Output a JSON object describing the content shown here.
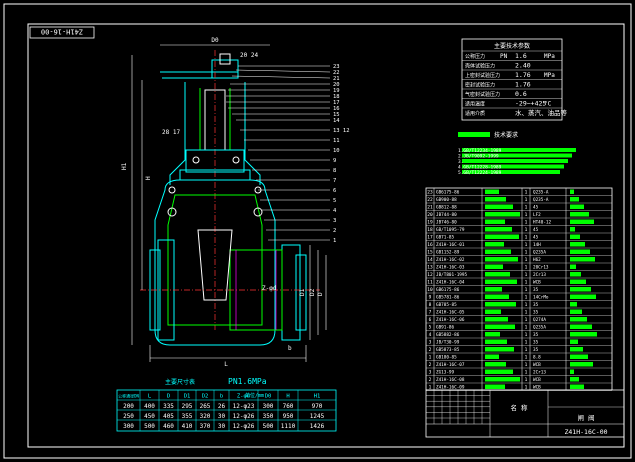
{
  "drawing": {
    "title_stamp": "Z41H-16-00",
    "dim_top": "D0",
    "dim_top2": "20 24",
    "dim_left": "H1",
    "dim_left2": "H",
    "dim_bottom": "L",
    "dim_mid": "28 17",
    "dim_flange_lbl": "D1",
    "dim_flange_lbl2": "D2",
    "dim_flange_lbl3": "D",
    "dim_z": "Z-φd",
    "dim_b": "b",
    "callouts_right": [
      "23",
      "22",
      "21",
      "20",
      "19",
      "18",
      "17",
      "16",
      "15",
      "14",
      "13 12",
      "11",
      "10",
      "9",
      "8",
      "7",
      "6",
      "5",
      "4",
      "3",
      "2",
      "1"
    ]
  },
  "spec": {
    "title": "主要技术参数",
    "rows": [
      {
        "label": "公称压力",
        "sym": "PN",
        "value": "1.6",
        "unit": "MPa"
      },
      {
        "label": "壳体试验压力",
        "sym": "",
        "value": "2.40",
        "unit": ""
      },
      {
        "label": "上密封试验压力",
        "sym": "",
        "value": "1.76",
        "unit": "MPa"
      },
      {
        "label": "密封试验压力",
        "sym": "",
        "value": "1.76",
        "unit": ""
      },
      {
        "label": "气密封试验压力",
        "sym": "",
        "value": "0.6",
        "unit": ""
      },
      {
        "label": "适用温度",
        "sym": "",
        "value": "-29~+425",
        "unit": "°C"
      },
      {
        "label": "适用介质",
        "sym": "",
        "value": "水、蒸汽、油品等",
        "unit": ""
      }
    ]
  },
  "tech_req": {
    "title": "技术要求",
    "items": [
      "1.GB/T12234-1989",
      "2.JB/T9092-1999",
      "3.",
      "4.GB/T12228-1989",
      "5.GB/T12224-1989"
    ]
  },
  "bom": {
    "rows": [
      {
        "no": "23",
        "code": "GB6175-86",
        "qty": "1",
        "mat": "Q235-A"
      },
      {
        "no": "22",
        "code": "GB900-88",
        "qty": "1",
        "mat": "Q235-A"
      },
      {
        "no": "21",
        "code": "GB812-88",
        "qty": "1",
        "mat": "45"
      },
      {
        "no": "20",
        "code": "JB744-80",
        "qty": "1",
        "mat": "LF2"
      },
      {
        "no": "19",
        "code": "JB746-80",
        "qty": "1",
        "mat": "HT40-12"
      },
      {
        "no": "18",
        "code": "GB/T1095-79",
        "qty": "1",
        "mat": "45"
      },
      {
        "no": "17",
        "code": "GB71-85",
        "qty": "1",
        "mat": "45"
      },
      {
        "no": "16",
        "code": "Z41H-16C-01",
        "qty": "1",
        "mat": "14H"
      },
      {
        "no": "15",
        "code": "GB1152-89",
        "qty": "1",
        "mat": "Q235A"
      },
      {
        "no": "14",
        "code": "Z41H-16C-02",
        "qty": "1",
        "mat": "H62"
      },
      {
        "no": "13",
        "code": "Z41H-16C-03",
        "qty": "1",
        "mat": "20Cr13"
      },
      {
        "no": "12",
        "code": "JB/T801-1995",
        "qty": "1",
        "mat": "2Cr13"
      },
      {
        "no": "11",
        "code": "Z41H-16C-04",
        "qty": "1",
        "mat": "WCB"
      },
      {
        "no": "10",
        "code": "GB6175-86",
        "qty": "1",
        "mat": "35"
      },
      {
        "no": "9",
        "code": "GB5781-86",
        "qty": "1",
        "mat": "14CrMo"
      },
      {
        "no": "8",
        "code": "GB785-85",
        "qty": "1",
        "mat": "35"
      },
      {
        "no": "7",
        "code": "Z41H-16C-05",
        "qty": "1",
        "mat": "35"
      },
      {
        "no": "6",
        "code": "Z41H-16C-06",
        "qty": "1",
        "mat": "Q274A"
      },
      {
        "no": "5",
        "code": "GB91-86",
        "qty": "1",
        "mat": "Q235A"
      },
      {
        "no": "4",
        "code": "GB5882-86",
        "qty": "1",
        "mat": "35"
      },
      {
        "no": "3",
        "code": "JB/T30-99",
        "qty": "1",
        "mat": "35"
      },
      {
        "no": "2",
        "code": "GB5873-85",
        "qty": "1",
        "mat": "35"
      },
      {
        "no": "1",
        "code": "GB180-85",
        "qty": "1",
        "mat": "8.8"
      },
      {
        "no": "2",
        "code": "Z41H-16C-07",
        "qty": "1",
        "mat": "WCB"
      },
      {
        "no": "3",
        "code": "ZG13-99",
        "qty": "1",
        "mat": "2Cr13"
      },
      {
        "no": "2",
        "code": "Z41H-16C-08",
        "qty": "1",
        "mat": "WCB"
      },
      {
        "no": "1",
        "code": "Z41H-16C-09",
        "qty": "1",
        "mat": "WCB"
      }
    ],
    "title_block_label": "名 称",
    "title_block_label2": "闸 阀",
    "drawing_no": "Z41H-16C-00"
  },
  "dims": {
    "title": "主要尺寸表",
    "pressure": "PN1.6MPa",
    "unit": "单位/mm",
    "headers": [
      "公称通径DN",
      "L",
      "D",
      "D1",
      "D2",
      "b",
      "Z-φd",
      "D0",
      "H",
      "H1"
    ],
    "rows": [
      [
        "200",
        "400",
        "335",
        "295",
        "265",
        "26",
        "12-φ23",
        "300",
        "760",
        "970"
      ],
      [
        "250",
        "450",
        "405",
        "355",
        "320",
        "30",
        "12-φ26",
        "350",
        "950",
        "1245"
      ],
      [
        "300",
        "500",
        "460",
        "410",
        "370",
        "30",
        "12-φ26",
        "500",
        "1110",
        "1426"
      ]
    ]
  },
  "tag": "Z41H-16C-00"
}
